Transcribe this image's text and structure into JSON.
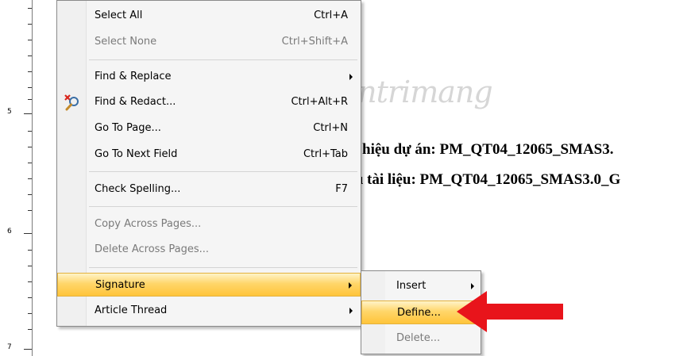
{
  "ruler": {
    "numbers": [
      "5",
      "6",
      "7"
    ]
  },
  "document": {
    "line1": "hiệu dự án:  PM_QT04_12065_SMAS3.",
    "line2": "ı tài liệu: PM_QT04_12065_SMAS3.0_G"
  },
  "watermark": {
    "text": "uantrimang"
  },
  "menu": {
    "items": [
      {
        "label": "Select All",
        "shortcut": "Ctrl+A"
      },
      {
        "label": "Select None",
        "shortcut": "Ctrl+Shift+A"
      },
      {
        "label": "Find & Replace",
        "shortcut": ""
      },
      {
        "label": "Find & Redact...",
        "shortcut": "Ctrl+Alt+R"
      },
      {
        "label": "Go To Page...",
        "shortcut": "Ctrl+N"
      },
      {
        "label": "Go To Next Field",
        "shortcut": "Ctrl+Tab"
      },
      {
        "label": "Check Spelling...",
        "shortcut": "F7"
      },
      {
        "label": "Copy Across Pages...",
        "shortcut": ""
      },
      {
        "label": "Delete Across Pages...",
        "shortcut": ""
      },
      {
        "label": "Signature",
        "shortcut": ""
      },
      {
        "label": "Article Thread",
        "shortcut": ""
      }
    ]
  },
  "submenu": {
    "items": [
      {
        "label": "Insert"
      },
      {
        "label": "Define..."
      },
      {
        "label": "Delete..."
      }
    ]
  },
  "colors": {
    "highlight": "#ffd66a",
    "arrow": "#e8141b"
  }
}
